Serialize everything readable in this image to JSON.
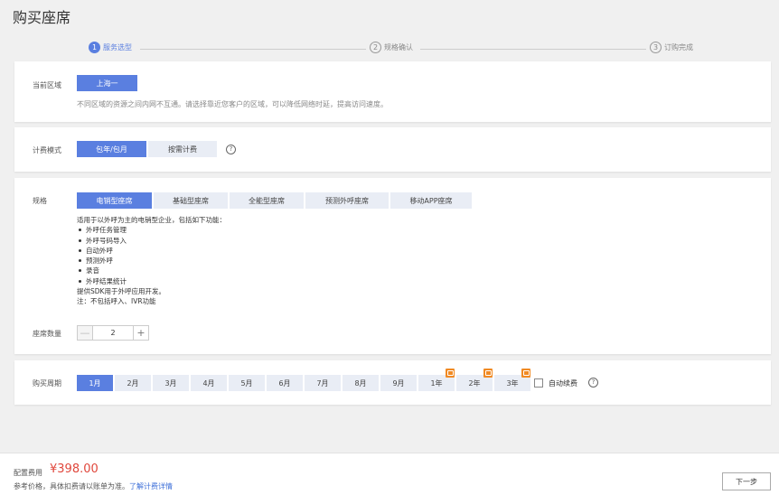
{
  "page": {
    "title": "购买座席"
  },
  "steps": [
    {
      "num": "1",
      "label": "服务选型",
      "active": true
    },
    {
      "num": "2",
      "label": "规格确认",
      "active": false
    },
    {
      "num": "3",
      "label": "订购完成",
      "active": false
    }
  ],
  "region": {
    "label": "当前区域",
    "selected": "上海一",
    "hint": "不同区域的资源之间内网不互通。请选择靠近您客户的区域，可以降低网络时延，提高访问速度。"
  },
  "billing": {
    "label": "计费模式",
    "options": [
      "包年/包月",
      "按需计费"
    ],
    "help": "?"
  },
  "spec": {
    "label": "规格",
    "tabs": [
      "电销型座席",
      "基础型座席",
      "全能型座席",
      "预测外呼座席",
      "移动APP座席"
    ],
    "intro": "适用于以外呼为主的电销型企业，包括如下功能：",
    "features": [
      "外呼任务管理",
      "外呼号码导入",
      "自动外呼",
      "预测外呼",
      "录音",
      "外呼结果统计"
    ],
    "sdk_note": "提供SDK用于外呼应用开发。",
    "note": "注：不包括呼入、IVR功能",
    "quantity_label": "座席数量",
    "quantity": "2",
    "minus": "—",
    "plus": "+"
  },
  "period": {
    "label": "购买周期",
    "options": [
      "1月",
      "2月",
      "3月",
      "4月",
      "5月",
      "6月",
      "7月",
      "8月",
      "9月",
      "1年",
      "2年",
      "3年"
    ],
    "auto_renew_label": "自动续费",
    "help": "?"
  },
  "footer": {
    "fee_label": "配置费用",
    "fee_value": "¥398.00",
    "note": "参考价格，具体扣费请以账单为准。",
    "link": "了解计费详情",
    "next": "下一步"
  },
  "colors": {
    "primary": "#5a7fe0",
    "price": "#e0473c",
    "badge": "#f08a24",
    "link": "#3d6fd8"
  }
}
